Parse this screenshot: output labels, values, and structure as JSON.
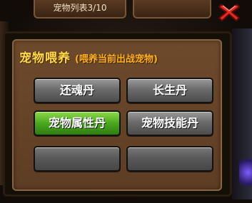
{
  "background": {
    "tab_left_label": "宠物列表3/10"
  },
  "popup": {
    "title": "宠物喂养",
    "subtitle": "(喂养当前出战宠物)",
    "buttons": [
      {
        "label": "还魂丹",
        "state": "normal"
      },
      {
        "label": "长生丹",
        "state": "normal"
      },
      {
        "label": "宠物属性丹",
        "state": "selected"
      },
      {
        "label": "宠物技能丹",
        "state": "normal"
      },
      {
        "label": "",
        "state": "empty"
      },
      {
        "label": "",
        "state": "empty"
      }
    ]
  },
  "icons": {
    "close": "close-x-icon"
  },
  "colors": {
    "title": "#ffd94a",
    "subtitle": "#ffb020",
    "selected_button": "#4aa81e",
    "close_icon": "#e02a22"
  }
}
